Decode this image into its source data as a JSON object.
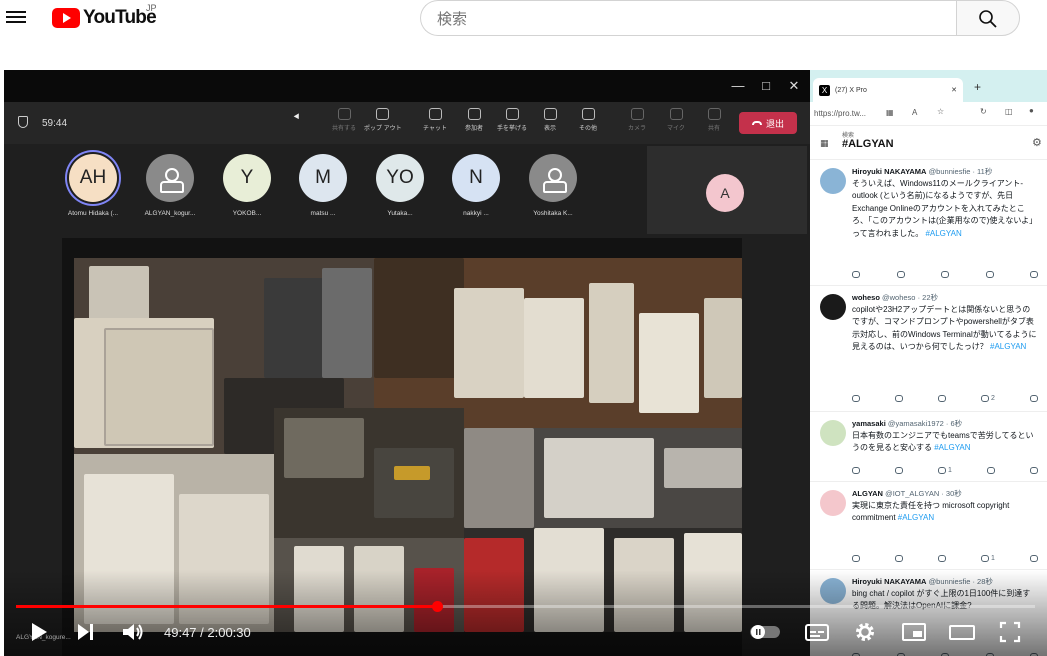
{
  "masthead": {
    "logo_text": "YouTube",
    "region": "JP",
    "search_placeholder": "検索"
  },
  "teams": {
    "timer": "59:44",
    "toolbar": [
      {
        "label": "共有する",
        "dim": true
      },
      {
        "label": "ポップ アウト",
        "dim": false
      },
      {
        "label": "チャット",
        "dim": false
      },
      {
        "label": "参加者",
        "dim": false
      },
      {
        "label": "手を挙げる",
        "dim": false
      },
      {
        "label": "表示",
        "dim": false
      },
      {
        "label": "その他",
        "dim": false
      },
      {
        "label": "カメラ",
        "dim": true
      },
      {
        "label": "マイク",
        "dim": true
      },
      {
        "label": "共有",
        "dim": true
      }
    ],
    "leave_label": "退出",
    "participants": [
      {
        "initials": "AH",
        "name": "Atomu Hidaka (...",
        "color": "#f6dfc4",
        "ring": true
      },
      {
        "initials": "",
        "name": "ALGYAN_kogur...",
        "color": "#8a8a8a",
        "ring": false
      },
      {
        "initials": "Y",
        "name": "YOKOB...",
        "color": "#e8eed7",
        "ring": false
      },
      {
        "initials": "M",
        "name": "matsu ...",
        "color": "#dde6ef",
        "ring": false
      },
      {
        "initials": "YO",
        "name": "Yutaka...",
        "color": "#dfe8ea",
        "ring": false
      },
      {
        "initials": "N",
        "name": "nakkyi ...",
        "color": "#d6e2f3",
        "ring": false
      },
      {
        "initials": "",
        "name": "Yoshitaka K...",
        "color": "#8a8a8a",
        "ring": false
      }
    ],
    "self_initial": "A"
  },
  "xwindow": {
    "tab_title": "(27) X Pro",
    "url": "https://pro.tw...",
    "search_label": "検索",
    "hashtag": "#ALGYAN",
    "tweets": [
      {
        "name": "Hiroyuki NAKAYAMA",
        "meta": "@bunniesfie · 11秒",
        "text": "そういえば、Windows11のメールクライアント-outlook (という名前)になるようですが、先日Exchange Onlineのアカウントを入れてみたところ、「このアカウントは(企業用なので)使えないよ」って言われました。",
        "tag": "#ALGYAN",
        "avatar_color": "#8ab4d6",
        "retweets": "",
        "likes": "",
        "views": ""
      },
      {
        "name": "woheso",
        "meta": "@woheso · 22秒",
        "text": "copilotや23H2アップデートとは関係ないと思うのですが、コマンドプロンプトやpowershellがタブ表示対応し、前のWindows Terminalが動いてるように見えるのは、いつから何でしたっけ？",
        "tag": "#ALGYAN",
        "avatar_color": "#1a1a1a",
        "retweets": "",
        "likes": "",
        "views": "2"
      },
      {
        "name": "yamasaki",
        "meta": "@yamasaki1972 · 6秒",
        "text": "日本有数のエンジニアでもteamsで苦労してるというのを見ると安心する",
        "tag": "#ALGYAN",
        "avatar_color": "#cfe3c0",
        "retweets": "",
        "likes": "1",
        "views": ""
      },
      {
        "name": "ALGYAN",
        "meta": "@IOT_ALGYAN · 30秒",
        "text": "実現に東京た責任を持つ microsoft copyright commitment",
        "tag": "#ALGYAN",
        "avatar_color": "#f4c7cc",
        "retweets": "",
        "likes": "",
        "views": "1"
      },
      {
        "name": "Hiroyuki NAKAYAMA",
        "meta": "@bunniesfie · 28秒",
        "text": "bing chat / copilot がすぐ上限の1日100件に到達する問題。解決法はOpenAIに課金?",
        "tag": "",
        "avatar_color": "#8ab4d6",
        "retweets": "",
        "likes": "",
        "views": ""
      }
    ]
  },
  "player": {
    "progress_fraction": 0.413,
    "current_time": "49:47",
    "duration": "2:00:30",
    "time_display": "49:47 / 2:00:30",
    "caption_overlay": "ALGYAN_kogure..."
  },
  "colors": {
    "youtube_red": "#ff0000",
    "leave_red": "#c4314b",
    "hashtag_blue": "#1d9bf0"
  }
}
